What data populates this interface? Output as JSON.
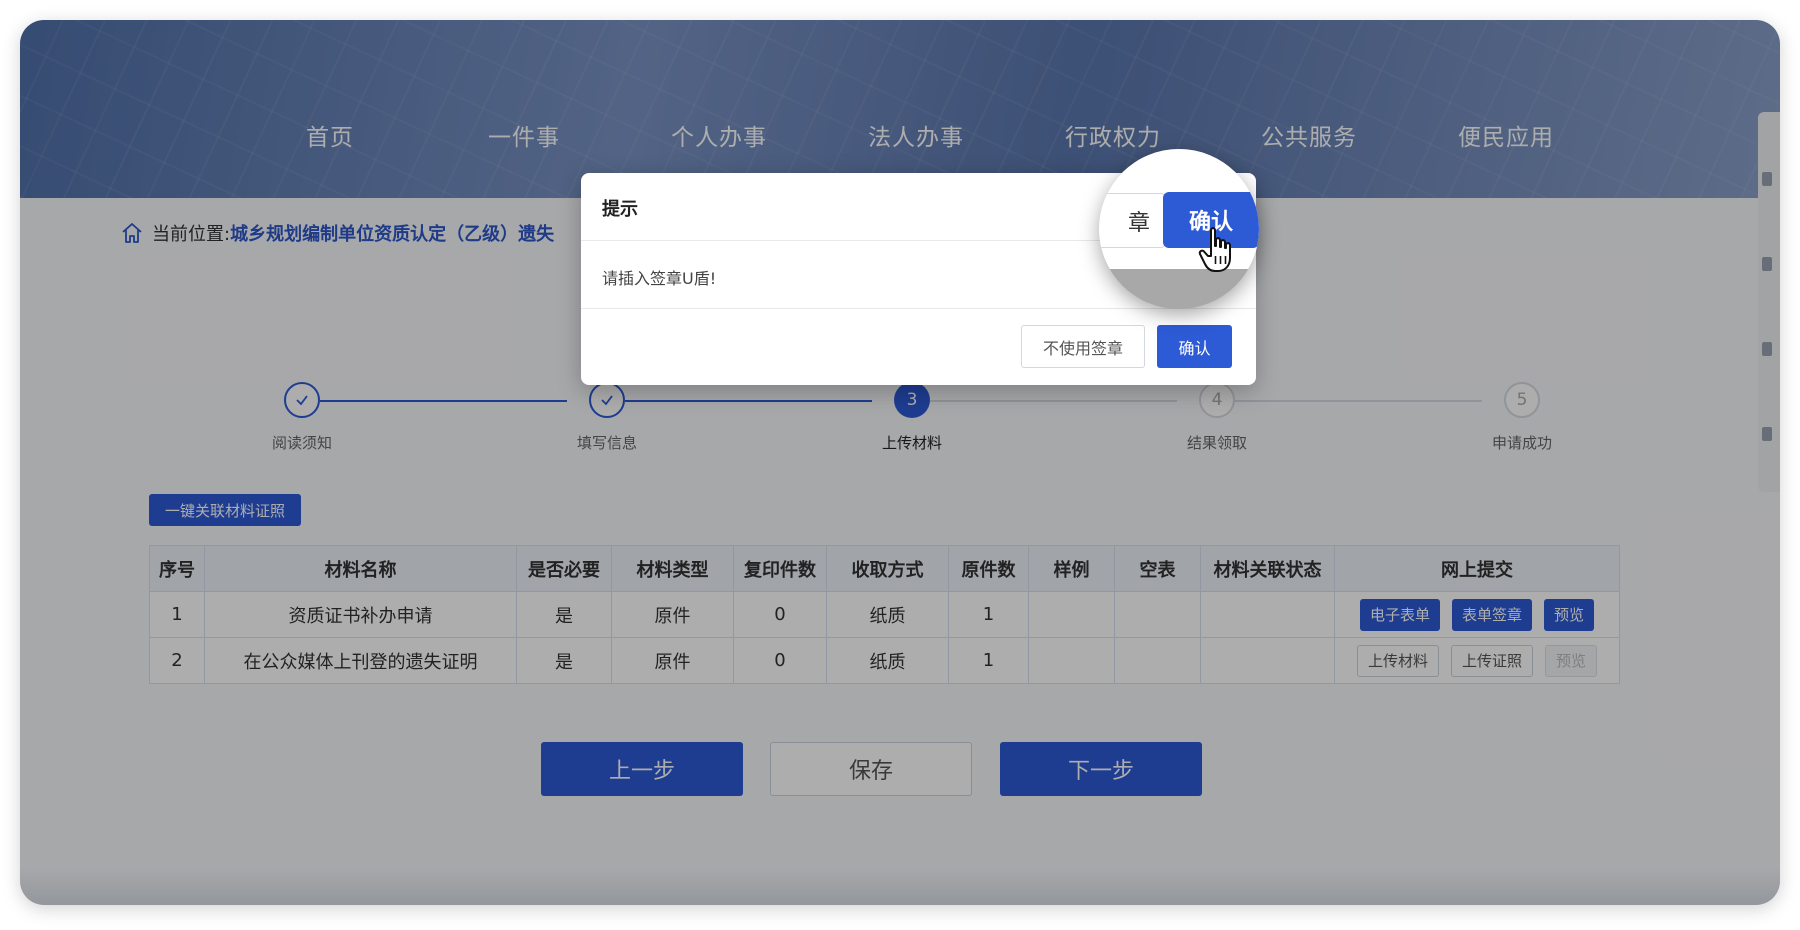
{
  "nav": [
    "首页",
    "一件事",
    "个人办事",
    "法人办事",
    "行政权力",
    "公共服务",
    "便民应用"
  ],
  "breadcrumb": {
    "prefix": "当前位置:",
    "link": "城乡规划编制单位资质认定（乙级）遗失"
  },
  "steps": [
    {
      "num": "1",
      "label": "阅读须知",
      "status": "done"
    },
    {
      "num": "2",
      "label": "填写信息",
      "status": "done"
    },
    {
      "num": "3",
      "label": "上传材料",
      "status": "active"
    },
    {
      "num": "4",
      "label": "结果领取",
      "status": "pending"
    },
    {
      "num": "5",
      "label": "申请成功",
      "status": "pending"
    }
  ],
  "link_button": "一键关联材料证照",
  "table": {
    "headers": [
      "序号",
      "材料名称",
      "是否必要",
      "材料类型",
      "复印件数",
      "收取方式",
      "原件数",
      "样例",
      "空表",
      "材料关联状态",
      "网上提交"
    ],
    "rows": [
      {
        "cells": [
          "1",
          "资质证书补办申请",
          "是",
          "原件",
          "0",
          "纸质",
          "1",
          "",
          "",
          ""
        ],
        "actions": [
          {
            "label": "电子表单",
            "style": "blue"
          },
          {
            "label": "表单签章",
            "style": "blue"
          },
          {
            "label": "预览",
            "style": "blue"
          }
        ]
      },
      {
        "cells": [
          "2",
          "在公众媒体上刊登的遗失证明",
          "是",
          "原件",
          "0",
          "纸质",
          "1",
          "",
          "",
          ""
        ],
        "actions": [
          {
            "label": "上传材料",
            "style": "outline"
          },
          {
            "label": "上传证照",
            "style": "outline"
          },
          {
            "label": "预览",
            "style": "disabled"
          }
        ]
      }
    ]
  },
  "buttons": {
    "prev": "上一步",
    "save": "保存",
    "next": "下一步"
  },
  "dialog": {
    "title": "提示",
    "message": "请插入签章U盾!",
    "no_seal": "不使用签章",
    "confirm": "确认"
  },
  "magnifier": {
    "edge_text": "章",
    "button_text": "确认"
  },
  "colors": {
    "primary": "#2d5bd6",
    "overlay": "rgba(0,0,0,0.32)"
  }
}
